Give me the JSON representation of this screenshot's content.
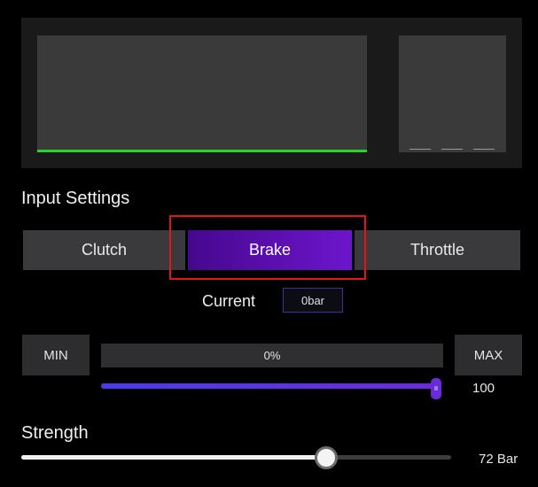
{
  "graph": {
    "line_color": "#23d723"
  },
  "input_settings": {
    "title": "Input Settings",
    "tabs": [
      {
        "label": "Clutch",
        "selected": false
      },
      {
        "label": "Brake",
        "selected": true
      },
      {
        "label": "Throttle",
        "selected": false
      }
    ],
    "accent_color": "#6d15cc",
    "highlight_color": "#e0161b"
  },
  "current": {
    "label": "Current",
    "value": "0bar"
  },
  "range": {
    "min_label": "MIN",
    "max_label": "MAX",
    "percent": "0%",
    "max_value": "100",
    "slider_fraction": 0.99
  },
  "strength": {
    "title": "Strength",
    "value_text": "72 Bar",
    "slider_fraction": 0.71
  }
}
